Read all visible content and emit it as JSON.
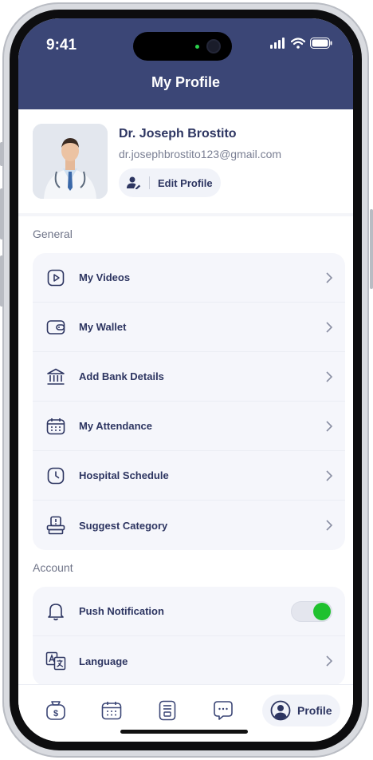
{
  "status_bar": {
    "time": "9:41",
    "icons": [
      "signal-icon",
      "wifi-icon",
      "battery-icon"
    ]
  },
  "header": {
    "title": "My Profile"
  },
  "profile": {
    "name": "Dr. Joseph Brostito",
    "email": "dr.josephbrostito123@gmail.com",
    "edit_label": "Edit Profile",
    "edit_icon": "user-edit-icon"
  },
  "general": {
    "title": "General",
    "items": [
      {
        "label": "My Videos",
        "icon": "video-icon"
      },
      {
        "label": "My Wallet",
        "icon": "wallet-icon"
      },
      {
        "label": "Add Bank Details",
        "icon": "bank-icon"
      },
      {
        "label": "My Attendance",
        "icon": "calendar-icon"
      },
      {
        "label": "Hospital Schedule",
        "icon": "clock-icon"
      },
      {
        "label": "Suggest Category",
        "icon": "suggest-icon"
      }
    ]
  },
  "account": {
    "title": "Account",
    "items": [
      {
        "label": "Push Notification",
        "icon": "bell-icon",
        "toggle_on": true
      },
      {
        "label": "Language",
        "icon": "language-icon"
      }
    ]
  },
  "bottom_nav": {
    "items": [
      {
        "icon": "money-bag-icon"
      },
      {
        "icon": "calendar-icon"
      },
      {
        "icon": "document-icon"
      },
      {
        "icon": "chat-icon"
      }
    ],
    "active": {
      "label": "Profile",
      "icon": "profile-icon"
    }
  },
  "colors": {
    "header": "#3b4676",
    "text_primary": "#2d3561",
    "toggle_on": "#1fc12e"
  }
}
